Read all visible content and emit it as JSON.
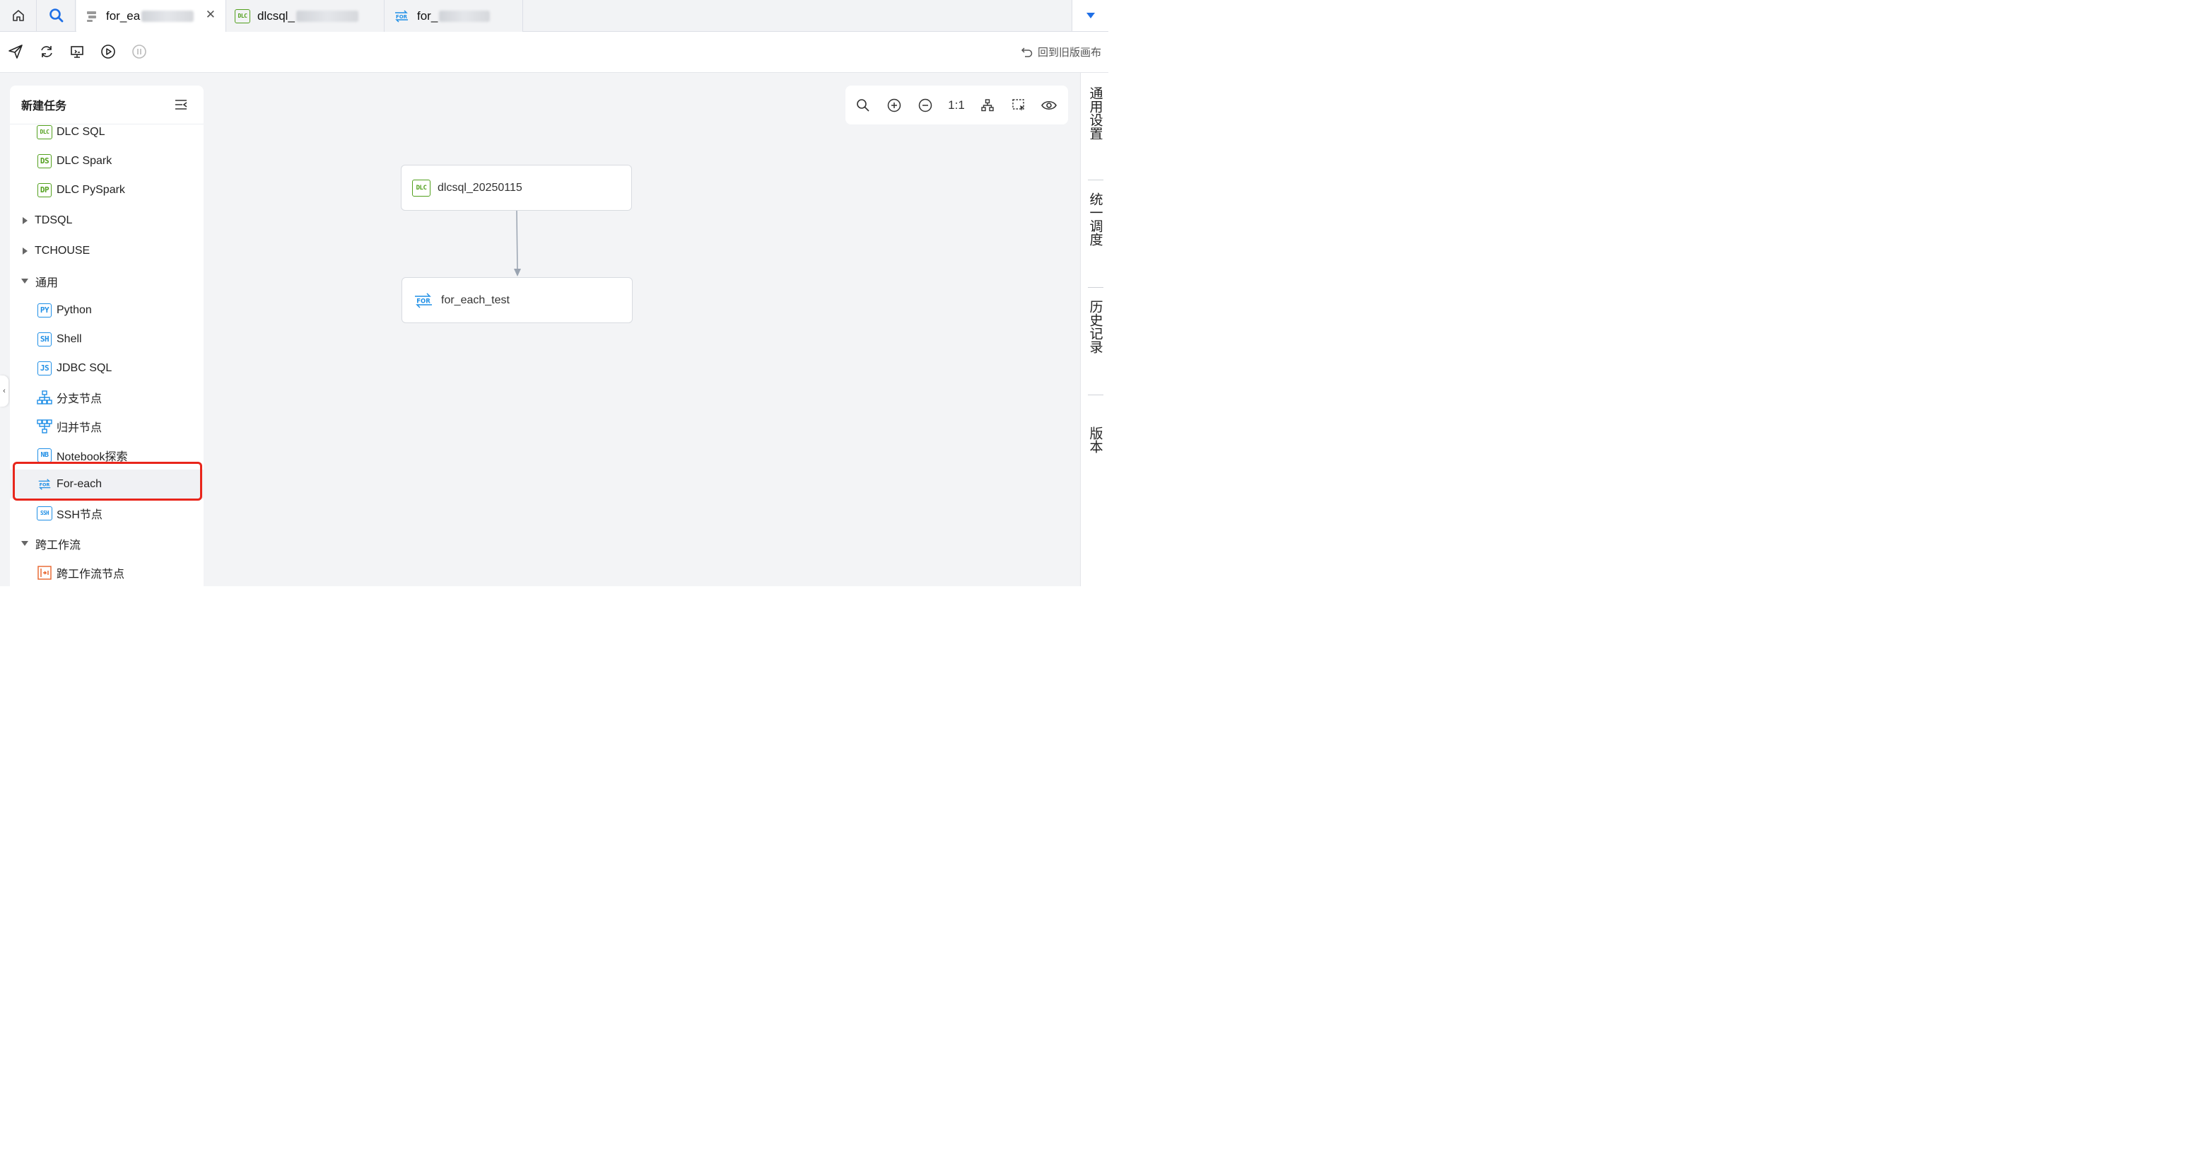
{
  "tabs": [
    {
      "label": "for_ea",
      "active": true
    },
    {
      "label": "dlcsql_",
      "active": false,
      "badge": "DLC"
    },
    {
      "label": "for_",
      "active": false,
      "badge": "FOR"
    }
  ],
  "toolbar": {
    "old_canvas": "回到旧版画布"
  },
  "panel": {
    "title": "新建任务",
    "items": [
      {
        "label": "DLC SQL",
        "badge": "DLC",
        "color": "#52a01d"
      },
      {
        "label": "DLC Spark",
        "badge": "DS",
        "color": "#52a01d"
      },
      {
        "label": "DLC PySpark",
        "badge": "DP",
        "color": "#52a01d"
      },
      {
        "label": "TDSQL"
      },
      {
        "label": "TCHOUSE"
      },
      {
        "label": "通用"
      },
      {
        "label": "Python",
        "badge": "PY",
        "color": "#1f8fe6"
      },
      {
        "label": "Shell",
        "badge": "SH",
        "color": "#1f8fe6"
      },
      {
        "label": "JDBC SQL",
        "badge": "JS",
        "color": "#1f8fe6"
      },
      {
        "label": "分支节点",
        "icon": "branch-icon"
      },
      {
        "label": "归并节点",
        "icon": "merge-icon"
      },
      {
        "label": "Notebook探索",
        "badge": "NB",
        "color": "#1f8fe6"
      },
      {
        "label": "For-each",
        "badge": "FOR",
        "color": "#1f8fe6"
      },
      {
        "label": "SSH节点",
        "badge": "SSH",
        "color": "#1f8fe6"
      },
      {
        "label": "跨工作流"
      },
      {
        "label": "跨工作流节点",
        "icon": "cross-workflow-icon"
      }
    ]
  },
  "canvas": {
    "zoom_ratio": "1:1",
    "nodes": [
      {
        "name": "dlcsql_20250115",
        "badge": "DLC"
      },
      {
        "name": "for_each_test",
        "badge": "FOR"
      }
    ]
  },
  "sidebar_right": {
    "items": [
      "通用设置",
      "统一调度",
      "历史记录",
      "版本"
    ]
  }
}
